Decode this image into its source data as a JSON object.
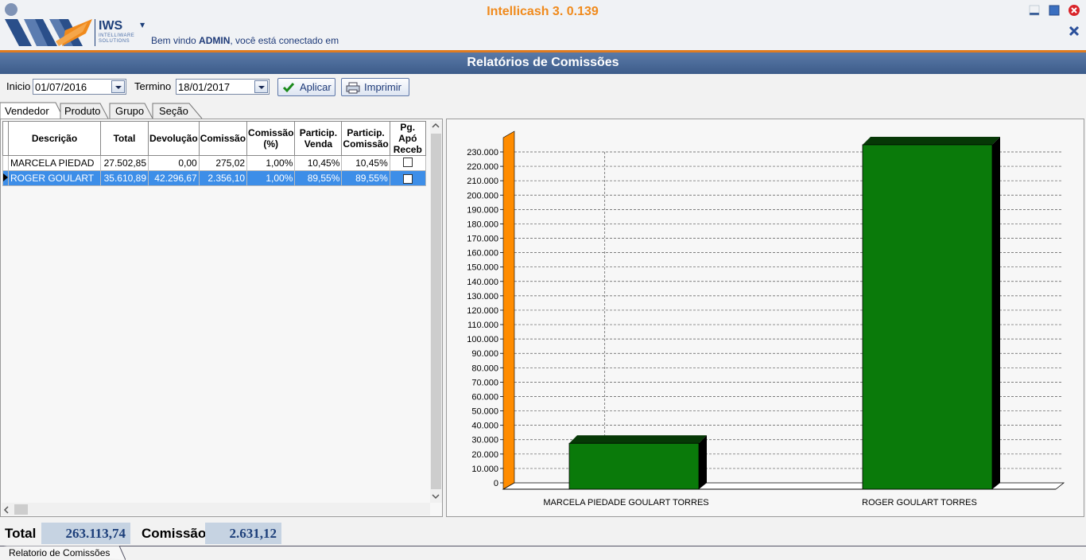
{
  "header": {
    "app_title": "Intellicash 3. 0.139",
    "logo_text": "IWS",
    "logo_sub_line1": "INTELLIWARE",
    "logo_sub_line2": "SOLUTIONS",
    "welcome_prefix": "Bem vindo ",
    "welcome_user": "ADMIN",
    "welcome_suffix": ", você está conectado em"
  },
  "banner": {
    "title": "Relatórios de Comissões"
  },
  "filters": {
    "start_label": "Inicio",
    "start_value": "01/07/2016",
    "end_label": "Termino",
    "end_value": "18/01/2017",
    "apply_label": "Aplicar",
    "print_label": "Imprimir"
  },
  "tabs": [
    {
      "label": "Vendedor",
      "active": true
    },
    {
      "label": "Produto",
      "active": false
    },
    {
      "label": "Grupo",
      "active": false
    },
    {
      "label": "Seção",
      "active": false
    }
  ],
  "grid": {
    "columns": [
      "Descrição",
      "Total",
      "Devolução",
      "Comissão",
      "Comissão (%)",
      "Particip. Venda",
      "Particip. Comissão",
      "Pg. Apó Receb"
    ],
    "rows": [
      {
        "descricao": "MARCELA PIEDAD",
        "total": "27.502,85",
        "devolucao": "0,00",
        "comissao": "275,02",
        "comissao_pct": "1,00%",
        "partic_venda": "10,45%",
        "partic_comissao": "10,45%",
        "pg_apos_receb": false,
        "selected": false
      },
      {
        "descricao": "ROGER GOULART",
        "total": "35.610,89",
        "devolucao": "42.296,67",
        "comissao": "2.356,10",
        "comissao_pct": "1,00%",
        "partic_venda": "89,55%",
        "partic_comissao": "89,55%",
        "pg_apos_receb": false,
        "selected": true
      }
    ]
  },
  "chart_data": {
    "type": "bar",
    "categories": [
      "MARCELA PIEDADE GOULART TORRES",
      "ROGER GOULART TORRES"
    ],
    "values": [
      27503,
      235000
    ],
    "ylim": [
      0,
      230000
    ],
    "y_ticks": [
      "0",
      "10.000",
      "20.000",
      "30.000",
      "40.000",
      "50.000",
      "60.000",
      "70.000",
      "80.000",
      "90.000",
      "100.000",
      "110.000",
      "120.000",
      "130.000",
      "140.000",
      "150.000",
      "160.000",
      "170.000",
      "180.000",
      "190.000",
      "200.000",
      "210.000",
      "220.000",
      "230.000"
    ],
    "bar_color": "#0a7a0a",
    "axis_wall_color": "#ff8c00",
    "grid": true,
    "title": "",
    "xlabel": "",
    "ylabel": ""
  },
  "footer": {
    "total_label": "Total",
    "total_value": "263.113,74",
    "comissao_label": "Comissão",
    "comissao_value": "2.631,12",
    "bottom_tab": "Relatorio de Comissões"
  }
}
